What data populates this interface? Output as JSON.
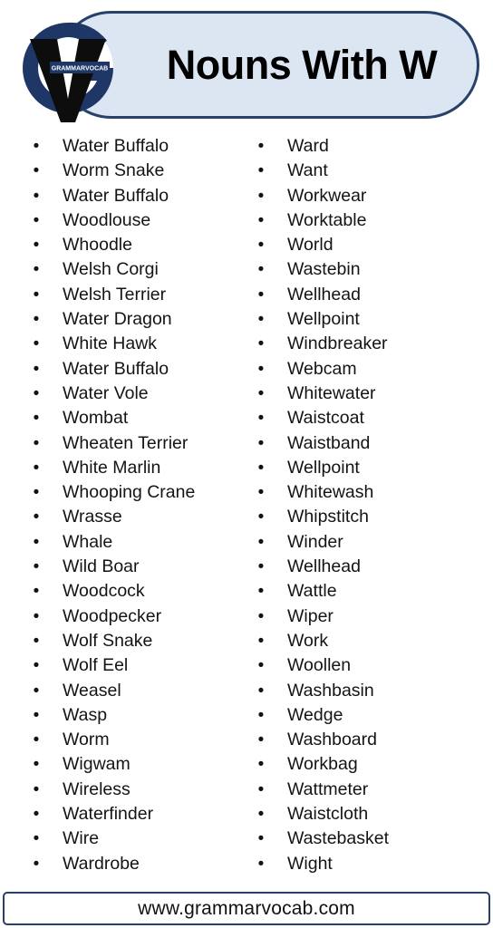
{
  "header": {
    "title": "Nouns With W",
    "logo": {
      "icon_name": "grammarvocab-logo",
      "brand_text": "GRAMMARVOCAB",
      "ring_color": "#1e3767",
      "v_color": "#0d0d0d"
    },
    "pill_fill": "#dce6f3",
    "pill_border": "#27416b"
  },
  "main": {
    "bullet_glyph": "•",
    "columns": [
      {
        "name": "left",
        "items": [
          "Water Buffalo",
          "Worm Snake",
          "Water Buffalo",
          "Woodlouse",
          "Whoodle",
          "Welsh Corgi",
          "Welsh Terrier",
          "Water Dragon",
          "White Hawk",
          "Water Buffalo",
          "Water Vole",
          "Wombat",
          "Wheaten Terrier",
          "White Marlin",
          "Whooping Crane",
          "Wrasse",
          "Whale",
          "Wild Boar",
          "Woodcock",
          "Woodpecker",
          "Wolf Snake",
          "Wolf Eel",
          "Weasel",
          "Wasp",
          "Worm",
          "Wigwam",
          "Wireless",
          "Waterfinder",
          "Wire",
          "Wardrobe"
        ]
      },
      {
        "name": "right",
        "items": [
          "Ward",
          "Want",
          "Workwear",
          "Worktable",
          "World",
          "Wastebin",
          "Wellhead",
          "Wellpoint",
          "Windbreaker",
          "Webcam",
          "Whitewater",
          "Waistcoat",
          "Waistband",
          "Wellpoint",
          "Whitewash",
          "Whipstitch",
          "Winder",
          "Wellhead",
          "Wattle",
          "Wiper",
          "Work",
          "Woollen",
          "Washbasin",
          "Wedge",
          "Washboard",
          "Workbag",
          "Wattmeter",
          "Waistcloth",
          "Wastebasket",
          "Wight"
        ]
      }
    ]
  },
  "footer": {
    "url": "www.grammarvocab.com",
    "border_color": "#27416b"
  }
}
